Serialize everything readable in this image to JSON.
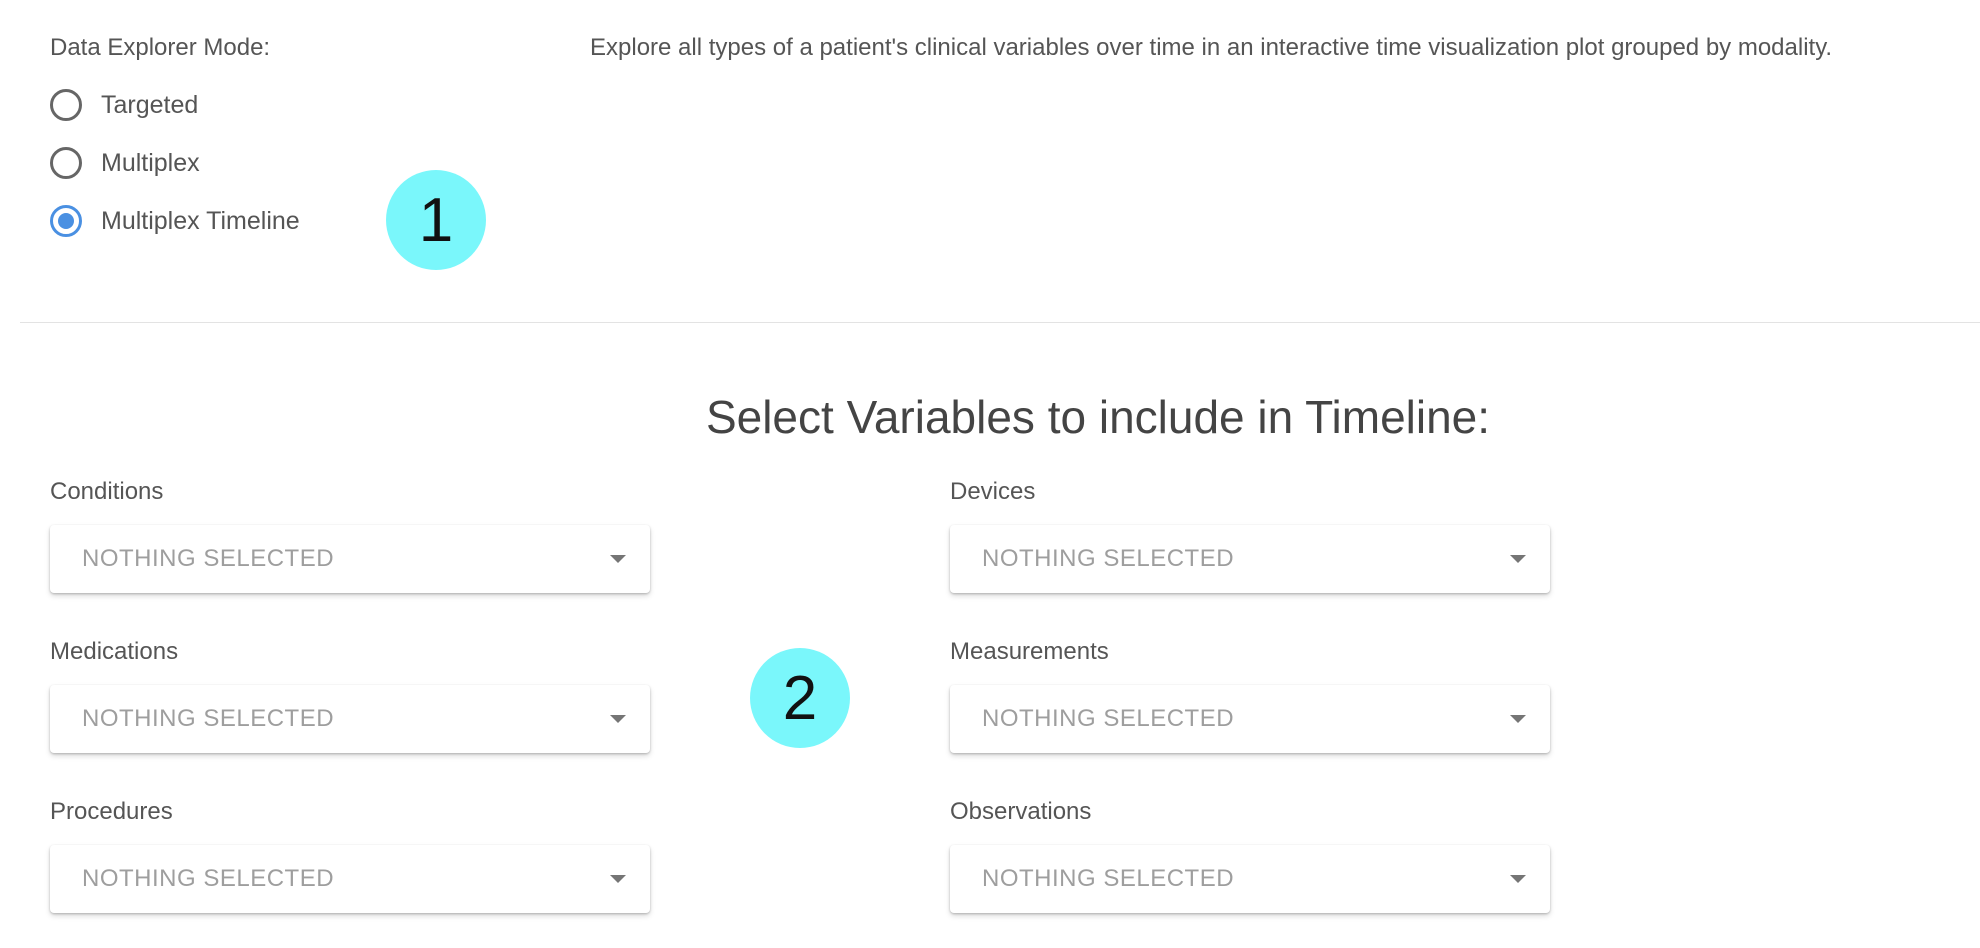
{
  "mode": {
    "label": "Data Explorer Mode:",
    "description": "Explore all types of a patient's clinical variables over time in an interactive time visualization plot grouped by modality.",
    "options": [
      {
        "label": "Targeted",
        "selected": false
      },
      {
        "label": "Multiplex",
        "selected": false
      },
      {
        "label": "Multiplex Timeline",
        "selected": true
      }
    ],
    "accent_color": "#4a90e2"
  },
  "markers": {
    "first": "1",
    "second": "2",
    "color": "#7af7fb"
  },
  "section": {
    "title": "Select Variables to include in Timeline:"
  },
  "fields": {
    "conditions": {
      "label": "Conditions",
      "value": "NOTHING SELECTED"
    },
    "medications": {
      "label": "Medications",
      "value": "NOTHING SELECTED"
    },
    "procedures": {
      "label": "Procedures",
      "value": "NOTHING SELECTED"
    },
    "devices": {
      "label": "Devices",
      "value": "NOTHING SELECTED"
    },
    "measurements": {
      "label": "Measurements",
      "value": "NOTHING SELECTED"
    },
    "observations": {
      "label": "Observations",
      "value": "NOTHING SELECTED"
    }
  }
}
